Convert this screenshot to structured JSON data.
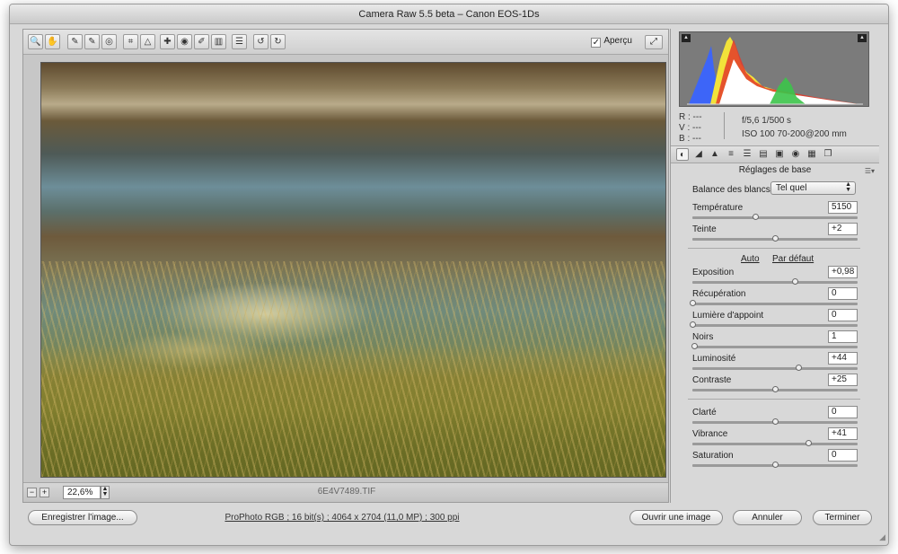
{
  "window": {
    "title": "Camera Raw 5.5 beta  –  Canon EOS-1Ds"
  },
  "toolbar": {
    "tools": [
      {
        "name": "zoom-tool-icon",
        "glyph": "🔍"
      },
      {
        "name": "hand-tool-icon",
        "glyph": "✋"
      },
      {
        "name": "white-balance-tool-icon",
        "glyph": "✎"
      },
      {
        "name": "color-sampler-tool-icon",
        "glyph": "✎"
      },
      {
        "name": "target-adjustment-tool-icon",
        "glyph": "◎"
      },
      {
        "name": "crop-tool-icon",
        "glyph": "⌗"
      },
      {
        "name": "straighten-tool-icon",
        "glyph": "△"
      },
      {
        "name": "retouch-tool-icon",
        "glyph": "✚"
      },
      {
        "name": "red-eye-tool-icon",
        "glyph": "◉"
      },
      {
        "name": "adjustment-brush-icon",
        "glyph": "✐"
      },
      {
        "name": "graduated-filter-icon",
        "glyph": "▥"
      },
      {
        "name": "preferences-icon",
        "glyph": "☰"
      },
      {
        "name": "rotate-left-icon",
        "glyph": "↺"
      },
      {
        "name": "rotate-right-icon",
        "glyph": "↻"
      }
    ],
    "preview_label": "Aperçu",
    "preview_checked": true
  },
  "status": {
    "zoom": "22,6%",
    "filename": "6E4V7489.TIF"
  },
  "info": {
    "rgb": [
      "R : ---",
      "V : ---",
      "B : ---"
    ],
    "aperture_shutter": "f/5,6   1/500 s",
    "iso_lens": "ISO 100   70-200@200 mm"
  },
  "panel": {
    "section_title": "Réglages de base",
    "white_balance_label": "Balance des blancs :",
    "white_balance_value": "Tel quel",
    "auto_link": "Auto",
    "default_link": "Par défaut",
    "sliders": [
      {
        "key": "temperature",
        "label": "Température",
        "value": "5150",
        "level": 0.38
      },
      {
        "key": "tint",
        "label": "Teinte",
        "value": "+2",
        "level": 0.5
      },
      {
        "key": "exposure",
        "label": "Exposition",
        "value": "+0,98",
        "level": 0.62
      },
      {
        "key": "recovery",
        "label": "Récupération",
        "value": "0",
        "level": 0.0
      },
      {
        "key": "fill-light",
        "label": "Lumière d'appoint",
        "value": "0",
        "level": 0.0
      },
      {
        "key": "blacks",
        "label": "Noirs",
        "value": "1",
        "level": 0.01
      },
      {
        "key": "brightness",
        "label": "Luminosité",
        "value": "+44",
        "level": 0.64
      },
      {
        "key": "contrast",
        "label": "Contraste",
        "value": "+25",
        "level": 0.5
      },
      {
        "key": "clarity",
        "label": "Clarté",
        "value": "0",
        "level": 0.5
      },
      {
        "key": "vibrance",
        "label": "Vibrance",
        "value": "+41",
        "level": 0.7
      },
      {
        "key": "saturation",
        "label": "Saturation",
        "value": "0",
        "level": 0.5
      }
    ]
  },
  "footer": {
    "save_label": "Enregistrer l'image...",
    "workflow_info": "ProPhoto RGB ; 16 bit(s) ; 4064 x 2704 (11,0 MP) ; 300 ppi",
    "open_label": "Ouvrir une image",
    "cancel_label": "Annuler",
    "done_label": "Terminer"
  },
  "colors": {
    "window_bg": "#d8d8d8",
    "histogram_bg": "#7b7b7b"
  }
}
